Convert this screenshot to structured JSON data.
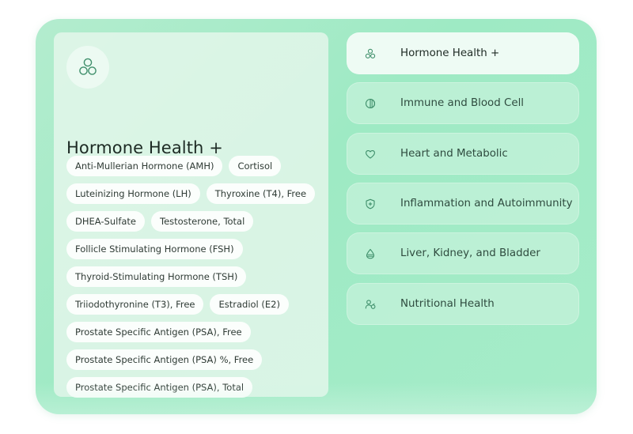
{
  "detail": {
    "icon": "three-circles-icon",
    "title": "Hormone Health +",
    "biomarkers": [
      "Anti-Mullerian Hormone (AMH)",
      "Cortisol",
      "Luteinizing Hormone (LH)",
      "Thyroxine (T4), Free",
      "DHEA-Sulfate",
      "Testosterone, Total",
      "Follicle Stimulating Hormone (FSH)",
      "Thyroid-Stimulating Hormone (TSH)",
      "Triiodothyronine (T3), Free",
      "Estradiol (E2)",
      "Prostate Specific Antigen (PSA), Free",
      "Prostate Specific Antigen (PSA) %, Free",
      "Prostate Specific Antigen (PSA), Total"
    ]
  },
  "menu": {
    "items": [
      {
        "label": "Hormone Health +",
        "icon": "three-circles-icon",
        "active": true
      },
      {
        "label": "Immune and Blood Cell",
        "icon": "half-circle-icon",
        "active": false
      },
      {
        "label": "Heart and Metabolic",
        "icon": "heart-icon",
        "active": false
      },
      {
        "label": "Inflammation and Autoimmunity",
        "icon": "shield-plus-icon",
        "active": false
      },
      {
        "label": "Liver, Kidney, and Bladder",
        "icon": "droplet-icon",
        "active": false
      },
      {
        "label": "Nutritional Health",
        "icon": "person-nutrition-icon",
        "active": false
      }
    ]
  },
  "colors": {
    "accent": "#3f8f6b",
    "frame_background": "#a6ecc9",
    "card_background": "#e5f7ec",
    "active_item_background": "#eefbf4"
  }
}
